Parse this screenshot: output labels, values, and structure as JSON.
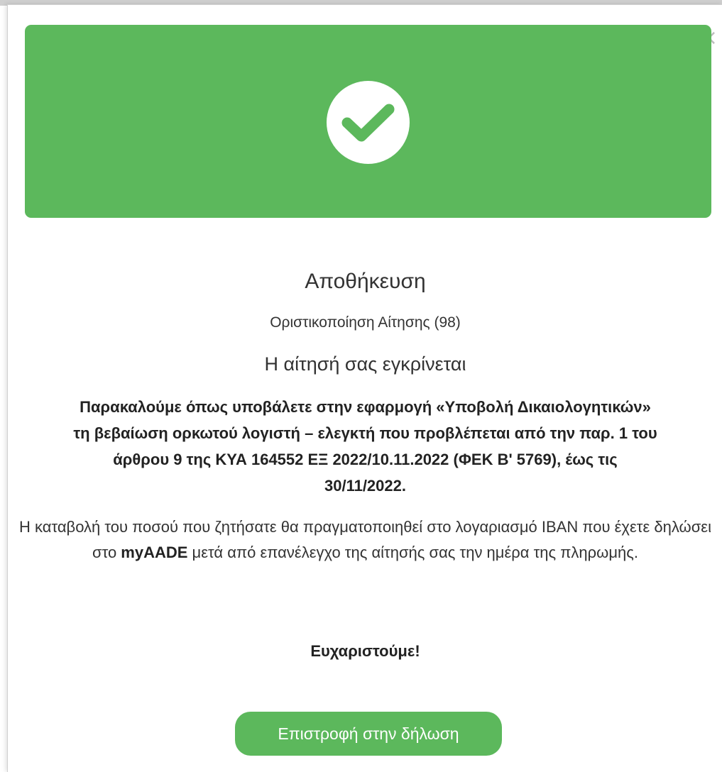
{
  "dialog": {
    "close_icon": "close-icon",
    "banner": {
      "icon": "check-icon",
      "color": "#5cb85c"
    },
    "title": "Αποθήκευση",
    "subtitle": "Οριστικοποίηση Αίτησης (98)",
    "approved": "Η αίτησή σας εγκρίνεται",
    "instruction": "Παρακαλούμε όπως υποβάλετε στην εφαρμογή «Υποβολή Δικαιολογητικών» τη βεβαίωση ορκωτού λογιστή – ελεγκτή που προβλέπεται από την παρ. 1 του άρθρου 9 της ΚΥΑ 164552 ΕΞ 2022/10.11.2022 (ΦΕΚ Β' 5769), έως τις 30/11/2022.",
    "payment": {
      "before": "Η καταβολή του ποσού που ζητήσατε θα πραγματοποιηθεί στο λογαριασμό IBAN που έχετε δηλώσει στο ",
      "brand": "myAADE",
      "after": " μετά από επανέλεγχο της αίτησής σας την ημέρα της πληρωμής."
    },
    "thanks": "Ευχαριστούμε!",
    "return_button": "Επιστροφή στην δήλωση"
  }
}
